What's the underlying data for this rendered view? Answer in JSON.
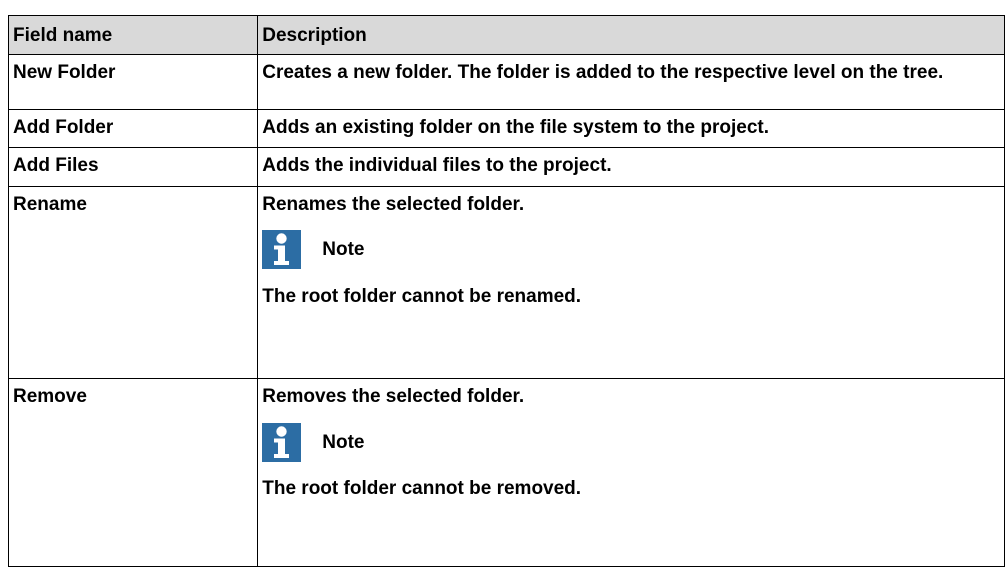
{
  "table": {
    "headers": {
      "field": "Field name",
      "description": "Description"
    },
    "rows": [
      {
        "field": "New Folder",
        "description": "Creates a new folder. The folder is added to the respective level on the tree."
      },
      {
        "field": "Add Folder",
        "description": "Adds an existing folder on the file system to the project."
      },
      {
        "field": "Add Files",
        "description": "Adds the individual files to the project."
      },
      {
        "field": "Rename",
        "description": "Renames the selected folder.",
        "note_label": "Note",
        "note_text": "The root folder cannot be renamed."
      },
      {
        "field": "Remove",
        "description": "Removes the selected folder.",
        "note_label": "Note",
        "note_text": "The root folder cannot be removed."
      }
    ]
  },
  "colors": {
    "header_background": "#d9d9d9",
    "note_icon": "#2c6da4"
  },
  "icons": {
    "note": "info-icon"
  }
}
